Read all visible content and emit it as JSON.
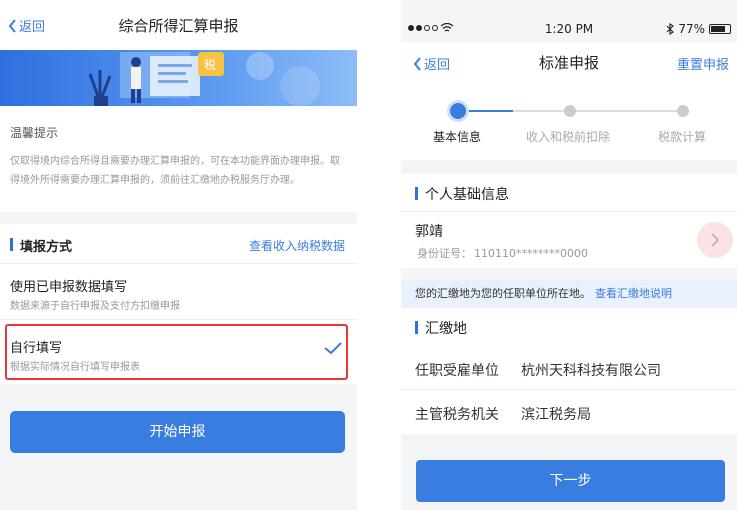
{
  "left": {
    "nav": {
      "back": "返回",
      "title": "综合所得汇算申报"
    },
    "banner": {
      "badge": "税"
    },
    "tips": {
      "title": "温馨提示",
      "body": "仅取得境内综合所得且需要办理汇算申报的，可在本功能界面办理申报。取得境外所得需要办理汇算申报的，须前往汇缴地办税服务厅办理。"
    },
    "fill_section": {
      "title": "填报方式",
      "link": "查看收入纳税数据",
      "options": [
        {
          "title": "使用已申报数据填写",
          "subtitle": "数据来源于自行申报及支付方扣缴申报",
          "selected": false
        },
        {
          "title": "自行填写",
          "subtitle": "根据实际情况自行填写申报表",
          "selected": true
        }
      ]
    },
    "start_button": "开始申报"
  },
  "right": {
    "status": {
      "time": "1:20 PM",
      "battery": "77%"
    },
    "nav": {
      "back": "返回",
      "title": "标准申报",
      "reset": "重置申报"
    },
    "steps": [
      {
        "label": "基本信息",
        "active": true
      },
      {
        "label": "收入和税前扣除",
        "active": false
      },
      {
        "label": "税款计算",
        "active": false
      }
    ],
    "personal": {
      "title": "个人基础信息",
      "name": "郭靖",
      "id_label": "身份证号：",
      "id_value": "110110********0000"
    },
    "notice": {
      "text": "您的汇缴地为您的任职单位所在地。",
      "link": "查看汇缴地说明"
    },
    "huijiao": {
      "title": "汇缴地",
      "rows": [
        {
          "label": "任职受雇单位",
          "value": "杭州天科科技有限公司"
        },
        {
          "label": "主管税务机关",
          "value": "滨江税务局"
        }
      ]
    },
    "next_button": "下一步"
  },
  "colors": {
    "accent": "#3a7de0",
    "highlight_frame": "#e53935"
  }
}
